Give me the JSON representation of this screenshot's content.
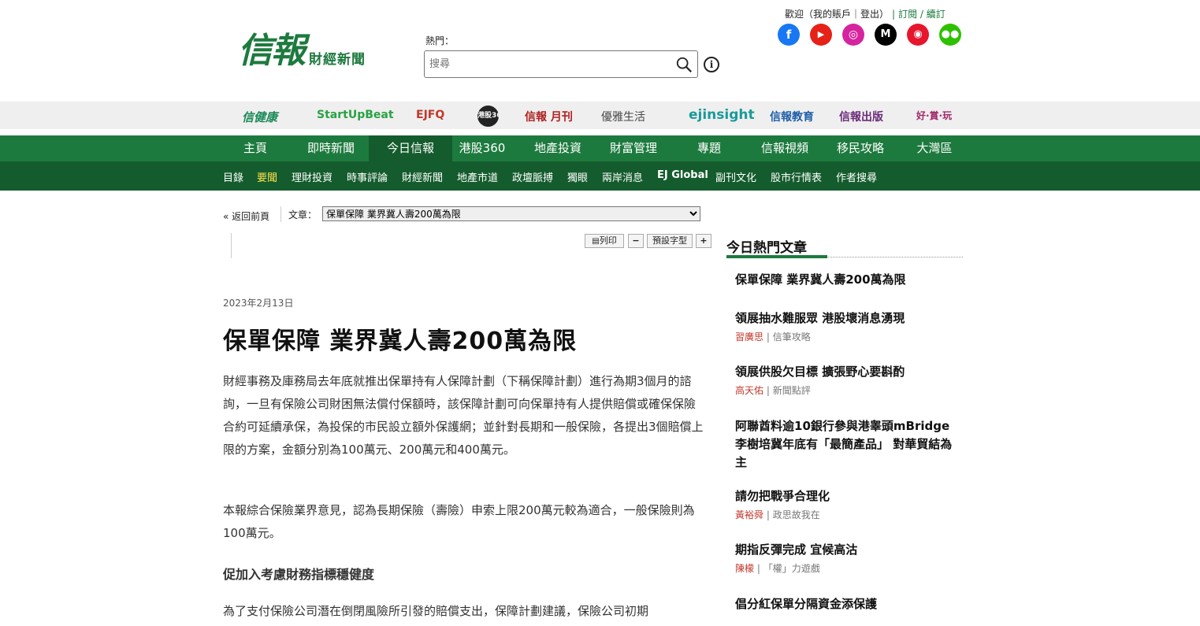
{
  "logo": {
    "main": "信報",
    "sub": "財經新聞"
  },
  "search": {
    "hot_label": "熱門：",
    "placeholder": "搜尋"
  },
  "account": {
    "welcome": "歡迎（我的賬戶｜登出）",
    "separator": "|",
    "subscribe": "訂閱 / 續訂"
  },
  "social": [
    "facebook-icon",
    "youtube-icon",
    "instagram-icon",
    "medium-icon",
    "weibo-icon",
    "wechat-icon"
  ],
  "brands": [
    "信健康",
    "StartUpBeat",
    "EJFQ",
    "港股360",
    "信報 月刊",
    "優雅生活",
    "ejinsight",
    "信報教育",
    "信報出版",
    "好·賞·玩"
  ],
  "mainnav": [
    "主頁",
    "即時新聞",
    "今日信報",
    "港股360",
    "地產投資",
    "財富管理",
    "專題",
    "信報視頻",
    "移民攻略",
    "大灣區"
  ],
  "subnav": [
    "目錄",
    "要聞",
    "理財投資",
    "時事評論",
    "財經新聞",
    "地產市道",
    "政壇脈搏",
    "獨眼",
    "兩岸消息",
    "EJ Global",
    "副刊文化",
    "股市行情表",
    "作者搜尋"
  ],
  "article": {
    "back": "« 返回前頁",
    "label": "文章：",
    "selected": "保單保障 業界冀人壽200萬為限",
    "tools": {
      "print": "列印",
      "minus": "−",
      "default_font": "預設字型",
      "plus": "+"
    },
    "date": "2023年2月13日",
    "title": "保單保障 業界冀人壽200萬為限",
    "paragraphs": [
      "財經事務及庫務局去年底就推出保單持有人保障計劃（下稱保障計劃）進行為期3個月的諮詢，一旦有保險公司財困無法償付保額時，該保障計劃可向保單持有人提供賠償或確保保險合約可延續承保，為投保的市民設立額外保護網；並針對長期和一般保險，各提出3個賠償上限的方案，金額分別為100萬元、200萬元和400萬元。",
      "本報綜合保險業界意見，認為長期保險（壽險）申索上限200萬元較為適合，一般保險則為100萬元。",
      "為了支付保險公司潛在倒閉風險所引發的賠償支出，保障計劃建議，保險公司初期"
    ],
    "subhead": "促加入考慮財務指標穩健度"
  },
  "sidebar": {
    "heading": "今日熱門文章",
    "items": [
      {
        "title": "保單保障 業界冀人壽200萬為限",
        "author": "",
        "column": ""
      },
      {
        "title": "領展抽水難服眾 港股壞消息湧現",
        "author": "習廣思",
        "column": "信筆攻略"
      },
      {
        "title": "領展供股欠目標 擴張野心要斟酌",
        "author": "高天佑",
        "column": "新聞點評"
      },
      {
        "title": "阿聯酋料逾10銀行參與港睾頭mBridge 李樹培冀年底有「最簡產品」 對華貿結為主",
        "author": "",
        "column": ""
      },
      {
        "title": "請勿把戰爭合理化",
        "author": "黃裕舜",
        "column": "政思故我在"
      },
      {
        "title": "期指反彈完成 宜候高沽",
        "author": "陳檬",
        "column": "「權」力遊戲"
      },
      {
        "title": "倡分紅保單分隔資金添保護",
        "author": "",
        "column": ""
      }
    ]
  }
}
